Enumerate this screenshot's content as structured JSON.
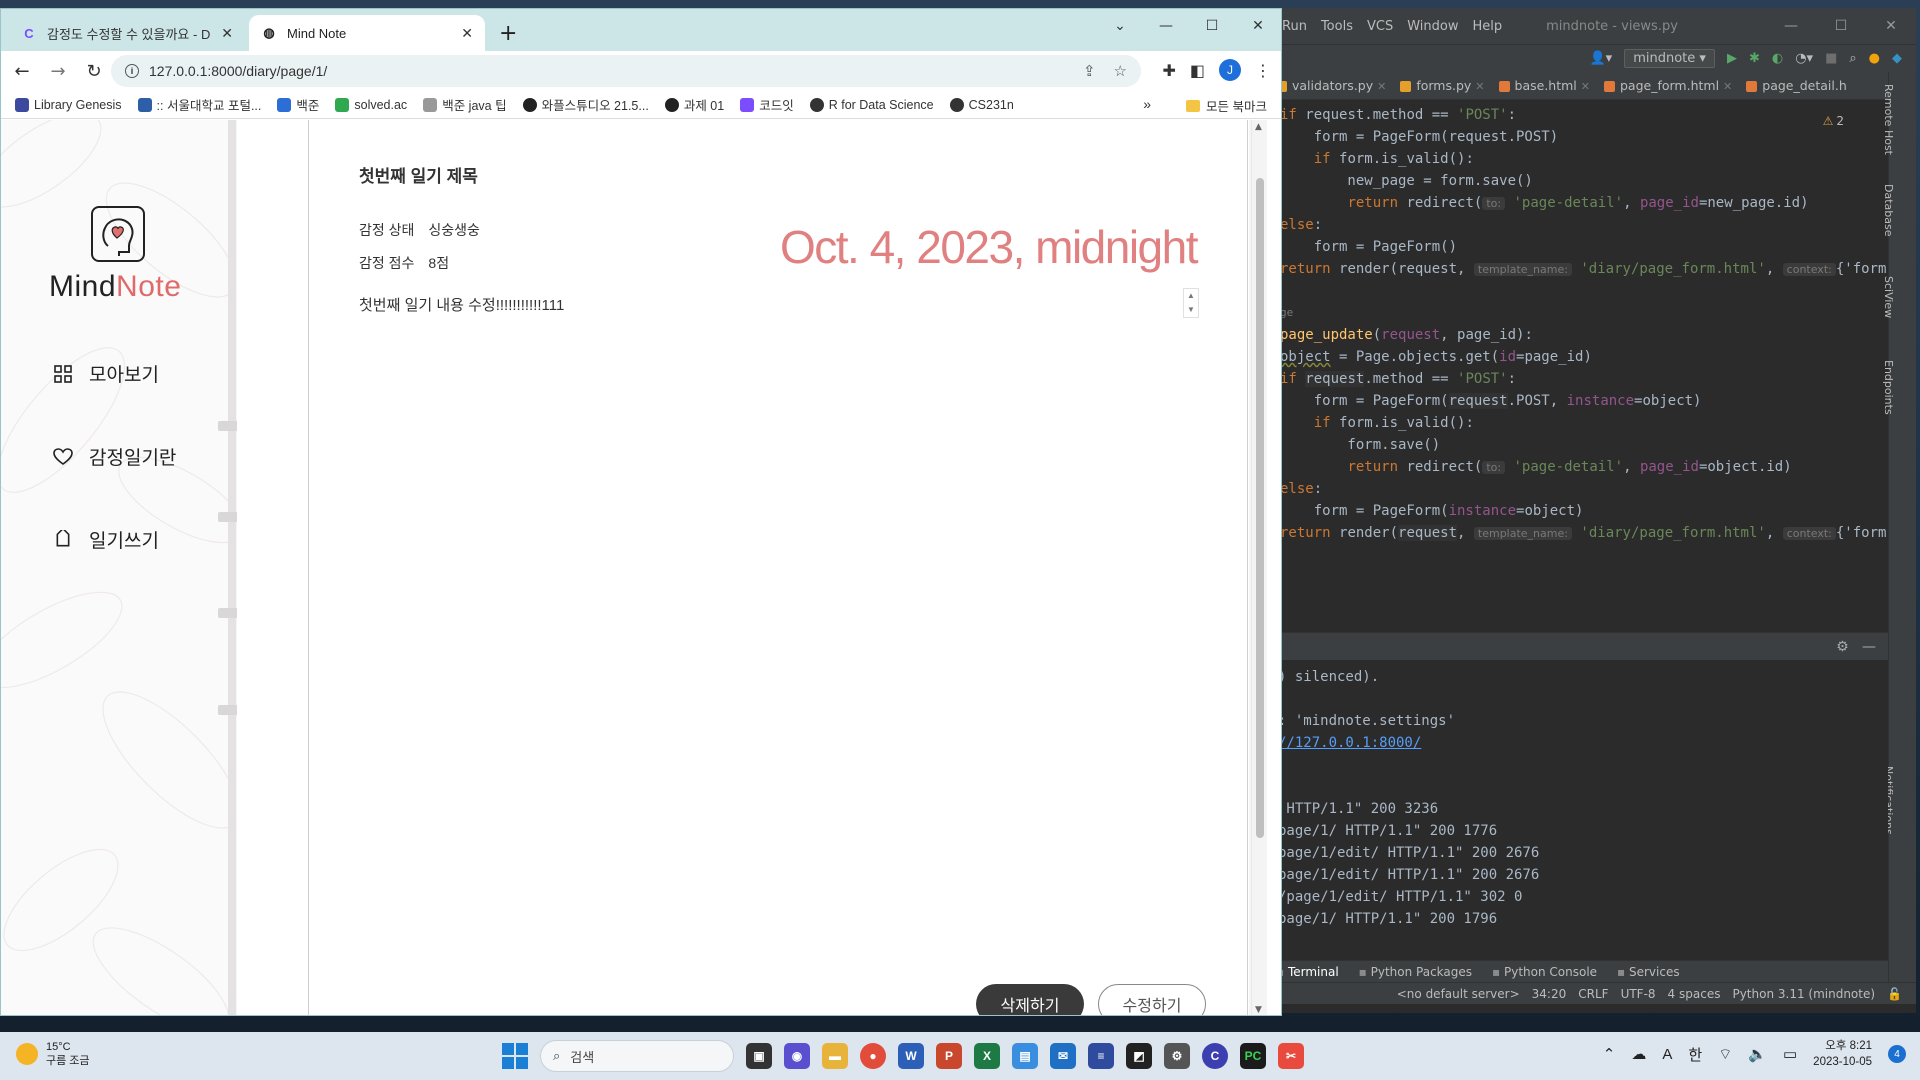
{
  "browser": {
    "tabs": [
      {
        "title": "감정도 수정할 수 있을까요 - D",
        "active": false
      },
      {
        "title": "Mind Note",
        "active": true
      }
    ],
    "url": "127.0.0.1:8000/diary/page/1/",
    "profile_initial": "J",
    "bookmarks": [
      "Library Genesis",
      ":: 서울대학교 포털...",
      "백준",
      "solved.ac",
      "백준 java 팁",
      "와플스튜디오 21.5...",
      "과제 01",
      "코드잇",
      "R for Data Science",
      "CS231n"
    ],
    "bookmarks_more": "»",
    "bookmarks_folder": "모든 북마크"
  },
  "page": {
    "brand_main": "Mind",
    "brand_accent": "Note",
    "nav": [
      {
        "label": "모아보기",
        "icon": "grid-icon"
      },
      {
        "label": "감정일기란",
        "icon": "heart-icon"
      },
      {
        "label": "일기쓰기",
        "icon": "tag-icon"
      }
    ],
    "diary": {
      "title": "첫번째 일기 제목",
      "feeling_label": "감정 상태",
      "feeling_value": "싱숭생숭",
      "score_label": "감정 점수",
      "score_value": "8점",
      "date": "Oct. 4, 2023, midnight",
      "content": "첫번째 일기 내용 수정!!!!!!!!!!!111"
    },
    "buttons": {
      "delete": "삭제하기",
      "edit": "수정하기"
    },
    "colors": {
      "accent": "#e06a6a",
      "date": "#e08080"
    }
  },
  "ide": {
    "menu": [
      "Run",
      "Tools",
      "VCS",
      "Window",
      "Help"
    ],
    "title": "mindnote - views.py",
    "run_config": "mindnote",
    "tabs": [
      "validators.py",
      "forms.py",
      "base.html",
      "page_form.html",
      "page_detail.h"
    ],
    "warning_count": "2",
    "code": {
      "l1_a": "if ",
      "l1_b": "request.method == ",
      "l1_c": "'POST'",
      "l1_d": ":",
      "l2_a": "    form = PageForm(request.POST)",
      "l3_a": "    ",
      "l3_b": "if ",
      "l3_c": "form.is_valid():",
      "l4_a": "        new_page = form.save()",
      "l5_a": "        ",
      "l5_b": "return ",
      "l5_c": "redirect(",
      "l5_hint": "to:",
      "l5_d": "'page-detail'",
      "l5_e": ", ",
      "l5_f": "page_id",
      "l5_g": "=new_page.id)",
      "l6_a": "else",
      "l6_b": ":",
      "l7_a": "    form = PageForm()",
      "l8_a": "return ",
      "l8_b": "render(request, ",
      "l8_hint1": "template_name:",
      "l8_c": "'diary/page_form.html'",
      "l8_d": ", ",
      "l8_hint2": "context:",
      "l8_e": "{'form': f",
      "l9_a": "ge",
      "l10_a": "page_update",
      "l10_b": "(",
      "l10_c": "request",
      "l10_d": ", page_id):",
      "l11_a": "object",
      "l11_b": " = Page.objects.get(",
      "l11_c": "id",
      "l11_d": "=page_id)",
      "l12_a": "if ",
      "l12_b": "request",
      "l12_c": ".method == ",
      "l12_d": "'POST'",
      "l12_e": ":",
      "l13_a": "    form = PageForm(",
      "l13_b": "request",
      "l13_c": ".POST, ",
      "l13_d": "instance",
      "l13_e": "=object)",
      "l14_a": "    ",
      "l14_b": "if ",
      "l14_c": "form.is_valid():",
      "l15_a": "        form.save()",
      "l16_a": "        ",
      "l16_b": "return ",
      "l16_c": "redirect(",
      "l16_hint": "to:",
      "l16_d": "'page-detail'",
      "l16_e": ", ",
      "l16_f": "page_id",
      "l16_g": "=object.id)",
      "l17_a": "else",
      "l17_b": ":",
      "l18_a": "    form = PageForm(",
      "l18_b": "instance",
      "l18_c": "=object)",
      "l19_a": "return ",
      "l19_b": "render(",
      "l19_c": "request",
      "l19_d": ", ",
      "l19_hint1": "template_name:",
      "l19_e": "'diary/page_form.html'",
      "l19_f": ", ",
      "l19_hint2": "context:",
      "l19_g": "{'form': f"
    },
    "terminal": [
      ") silenced).",
      "",
      ": 'mindnote.settings'",
      "//127.0.0.1:8000/",
      "",
      "",
      " HTTP/1.1\" 200 3236",
      "page/1/ HTTP/1.1\" 200 1776",
      "page/1/edit/ HTTP/1.1\" 200 2676",
      "page/1/edit/ HTTP/1.1\" 200 2676",
      "/page/1/edit/ HTTP/1.1\" 302 0",
      "page/1/ HTTP/1.1\" 200 1796"
    ],
    "side_labels": [
      "Remote Host",
      "Database",
      "SciView",
      "Endpoints",
      "Notifications"
    ],
    "bottom_tabs": [
      "Terminal",
      "Python Packages",
      "Python Console",
      "Services"
    ],
    "status": [
      "<no default server>",
      "34:20",
      "CRLF",
      "UTF-8",
      "4 spaces",
      "Python 3.11 (mindnote)"
    ]
  },
  "taskbar": {
    "temp": "15°C",
    "weather": "구름 조금",
    "search_placeholder": "검색",
    "ime": "한",
    "font_indicator": "A",
    "time": "오후 8:21",
    "date": "2023-10-05",
    "notifications": "4"
  }
}
